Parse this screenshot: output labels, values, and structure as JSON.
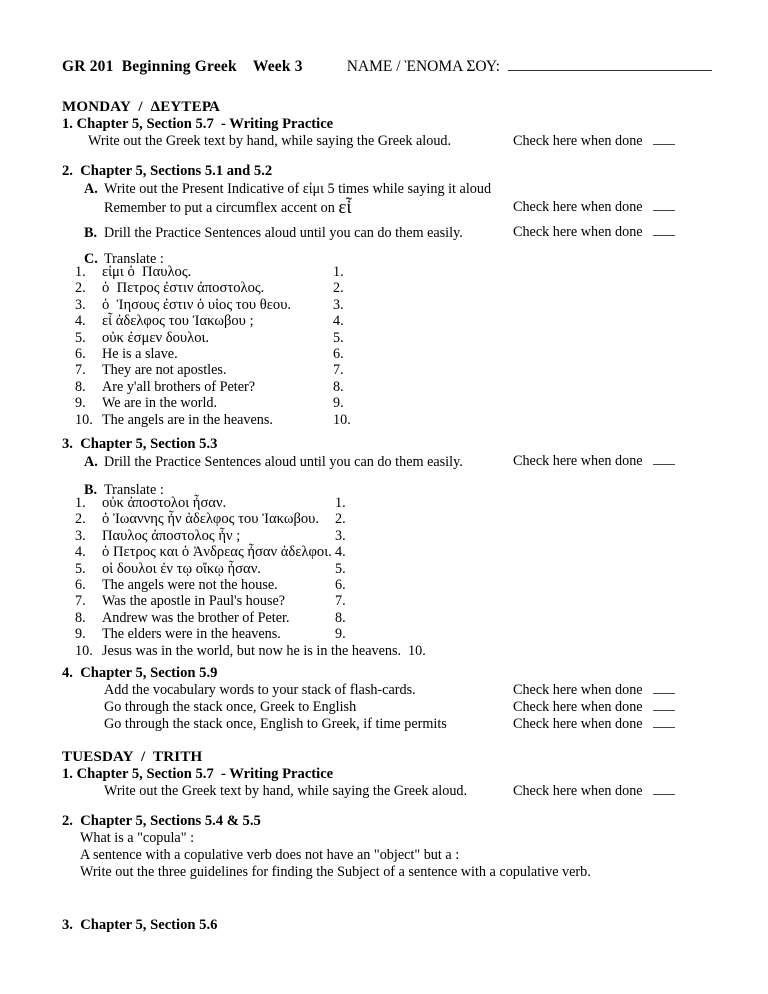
{
  "header": {
    "course": "GR 201  Beginning Greek    Week 3",
    "name_label": "NAME / ῈΝΟΜΑ ΣΟΥ:"
  },
  "check_label": "Check here when done",
  "days": [
    {
      "heading": "MONDAY  /  ΔΕΥΤΕΡΑ",
      "items": [
        {
          "head": "1. Chapter 5, Section 5.7  - Writing Practice",
          "lines": [
            "Write out the Greek text by hand, while saying the Greek aloud."
          ]
        },
        {
          "head": "2.  Chapter 5, Sections 5.1 and 5.2",
          "sub_a_letter": "A.",
          "sub_a_line1": "Write out the Present Indicative of εἰμι 5 times while saying it aloud",
          "sub_a_line2_pre": "Remember to put a circumflex accent on ",
          "sub_a_line2_word": "εἶ",
          "sub_b_letter": "B.",
          "sub_b_line": "Drill the Practice Sentences aloud until you can do them easily.",
          "sub_c_letter": "C.",
          "sub_c_line": "Translate :",
          "sentences": [
            "εἰμι ὁ  Παυλος.",
            "ὁ  Πετρος ἐστιν ἀποστολος.",
            "ὁ  Ἰησους ἐστιν ὁ υἱος του θεου.",
            "εἶ ἀδελφος του Ἰακωβου ;",
            "οὐκ ἐσμεν δουλοι.",
            "He is a slave.",
            "They are not apostles.",
            "Are y'all brothers of Peter?",
            "We are in the world.",
            "The angels are in the heavens."
          ],
          "numbers": [
            "1.",
            "2.",
            "3.",
            "4.",
            "5.",
            "6.",
            "7.",
            "8.",
            "9.",
            "10."
          ]
        },
        {
          "head": "3.  Chapter 5, Section 5.3",
          "sub_a_letter": "A.",
          "sub_a_line": "Drill the Practice Sentences aloud until you can do them easily.",
          "sub_b_letter": "B.",
          "sub_b_line": "Translate :",
          "sentences": [
            "οὐκ ἀποστολοι ἦσαν.",
            "ὁ Ἰωαννης ἦν ἀδελφος του Ἰακωβου.",
            "Παυλος ἀποστολος ἦν ;",
            "ὁ Πετρος και ὁ Ἀνδρεας ἦσαν ἀδελφοι.",
            "οἱ δουλοι ἐν τῳ οἴκῳ ἦσαν.",
            "The angels were not the house.",
            "Was the apostle in Paul's house?",
            "Andrew was the brother of Peter.",
            "The elders were in the heavens.",
            "Jesus was in the world, but now he is in the heavens."
          ],
          "numbers": [
            "1.",
            "2.",
            "3.",
            "4.",
            "5.",
            "6.",
            "7.",
            "8.",
            "9.",
            "10."
          ]
        },
        {
          "head": "4.  Chapter 5, Section 5.9",
          "lines": [
            "Add the vocabulary words to your stack of flash-cards.",
            "Go through the stack once, Greek to English",
            "Go through the stack once, English to Greek, if time permits"
          ]
        }
      ]
    },
    {
      "heading": "TUESDAY  /  TRITH",
      "items": [
        {
          "head": "1. Chapter 5, Section 5.7  - Writing Practice",
          "lines": [
            "Write out the Greek text by hand, while saying the Greek aloud."
          ]
        },
        {
          "head": "2.  Chapter 5, Sections 5.4 & 5.5",
          "lines": [
            "What is a \"copula\" :",
            "A sentence with a copulative verb does not have an \"object\" but a :",
            "Write out the three guidelines for finding the Subject of a sentence with a copulative verb."
          ]
        },
        {
          "head": "3.  Chapter 5, Section 5.6"
        }
      ]
    }
  ]
}
